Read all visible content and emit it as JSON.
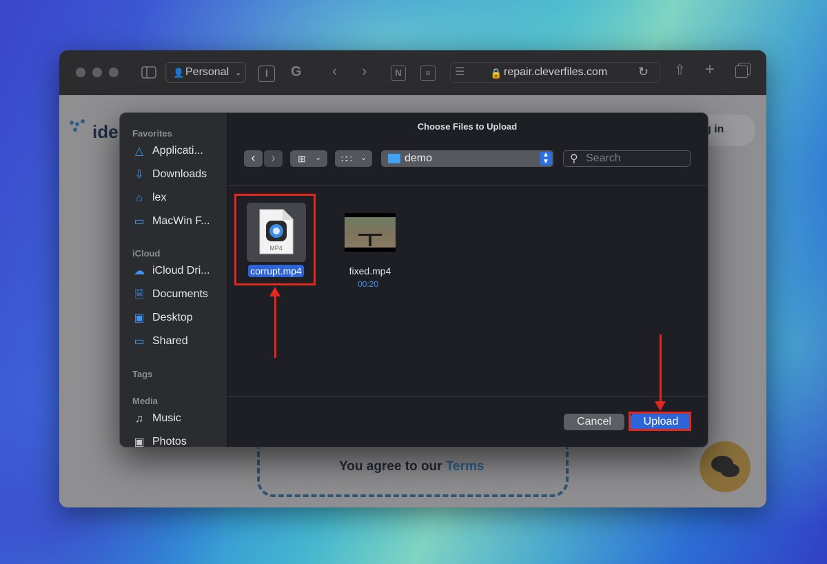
{
  "browser": {
    "profile_label": "Personal",
    "url": "repair.cleverfiles.com"
  },
  "page": {
    "logo_partial": "ide",
    "login_partial": "g in",
    "agree_text": "You agree to our",
    "terms_link": "Terms"
  },
  "dialog": {
    "title": "Choose Files to Upload",
    "path_folder": "demo",
    "search_placeholder": "Search",
    "sidebar": {
      "favorites_header": "Favorites",
      "favorites": [
        {
          "label": "Applicati...",
          "icon": "applications-icon"
        },
        {
          "label": "Downloads",
          "icon": "downloads-icon"
        },
        {
          "label": "lex",
          "icon": "home-icon"
        },
        {
          "label": "MacWin F...",
          "icon": "folder-icon"
        }
      ],
      "icloud_header": "iCloud",
      "icloud": [
        {
          "label": "iCloud Dri...",
          "icon": "cloud-icon"
        },
        {
          "label": "Documents",
          "icon": "document-icon"
        },
        {
          "label": "Desktop",
          "icon": "desktop-icon"
        },
        {
          "label": "Shared",
          "icon": "shared-folder-icon"
        }
      ],
      "tags_header": "Tags",
      "media_header": "Media",
      "media": [
        {
          "label": "Music",
          "icon": "music-icon"
        },
        {
          "label": "Photos",
          "icon": "camera-icon"
        }
      ]
    },
    "files": [
      {
        "name": "corrupt.mp4",
        "badge": "MP4",
        "selected": true
      },
      {
        "name": "fixed.mp4",
        "duration": "00:20",
        "selected": false
      }
    ],
    "cancel_label": "Cancel",
    "upload_label": "Upload"
  },
  "annotation_color": "#e0281f",
  "accent_color": "#2d64d8"
}
